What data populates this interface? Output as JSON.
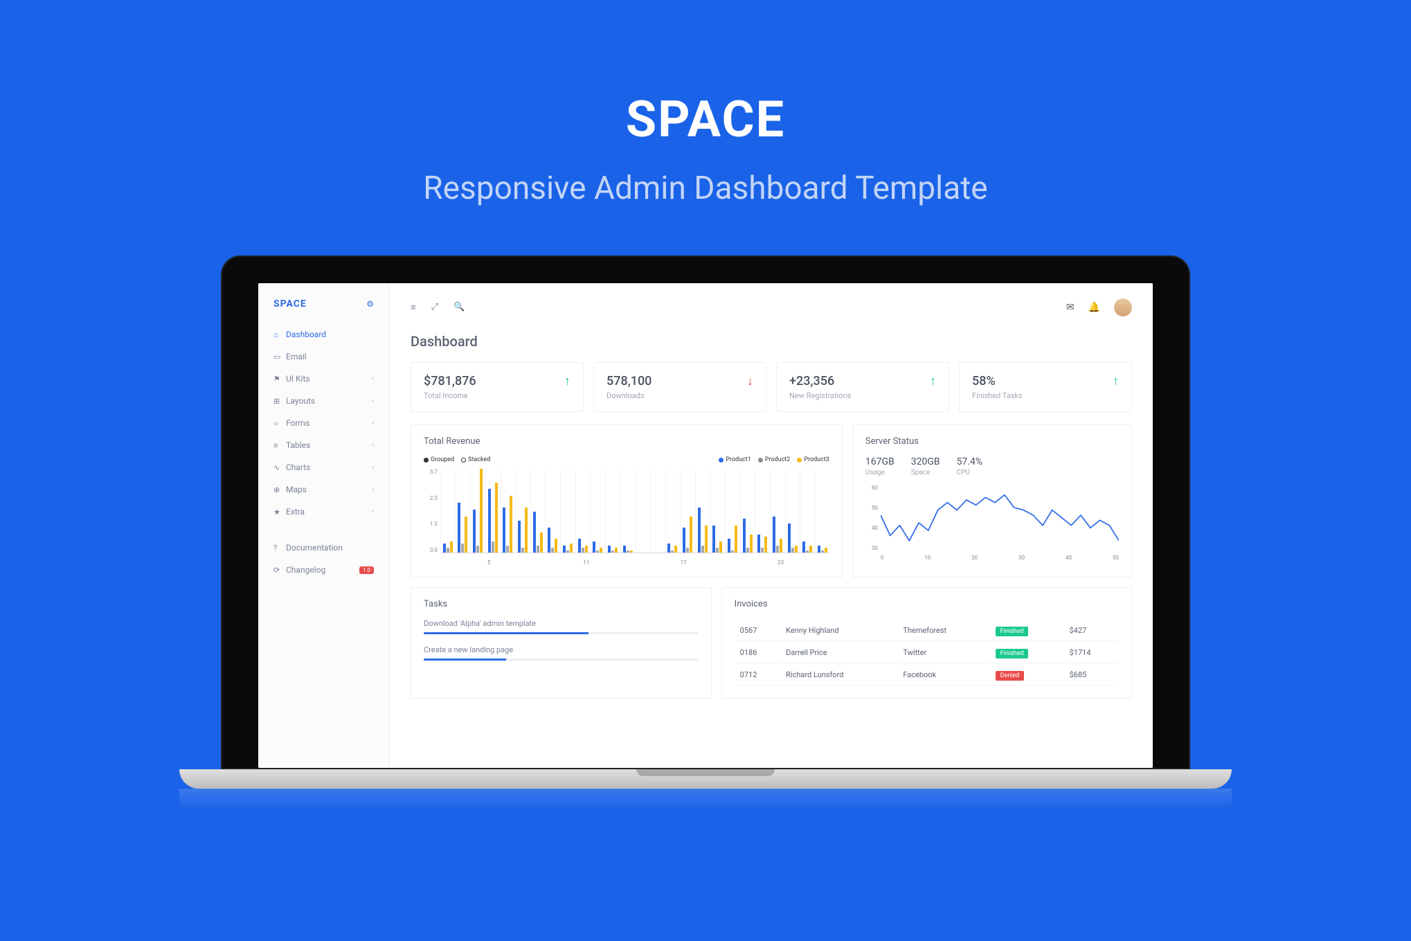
{
  "hero": {
    "title": "SPACE",
    "subtitle": "Responsive Admin Dashboard Template"
  },
  "sidebar": {
    "logo": "SPACE",
    "items": [
      {
        "icon": "⌂",
        "label": "Dashboard",
        "active": true
      },
      {
        "icon": "▭",
        "label": "Email"
      },
      {
        "icon": "⚑",
        "label": "UI Kits",
        "expand": true
      },
      {
        "icon": "⊞",
        "label": "Layouts",
        "expand": true
      },
      {
        "icon": "‹›",
        "label": "Forms",
        "expand": true
      },
      {
        "icon": "≡",
        "label": "Tables",
        "expand": true
      },
      {
        "icon": "∿",
        "label": "Charts",
        "expand": true
      },
      {
        "icon": "⊕",
        "label": "Maps",
        "expand": true
      },
      {
        "icon": "★",
        "label": "Extra",
        "expand": true
      }
    ],
    "footer": [
      {
        "icon": "?",
        "label": "Documentation"
      },
      {
        "icon": "⟳",
        "label": "Changelog",
        "badge": "1.0"
      }
    ]
  },
  "page": {
    "title": "Dashboard"
  },
  "stats": [
    {
      "value": "$781,876",
      "label": "Total Income",
      "trend": "up"
    },
    {
      "value": "578,100",
      "label": "Downloads",
      "trend": "down"
    },
    {
      "value": "+23,356",
      "label": "New Registrations",
      "trend": "up"
    },
    {
      "value": "58%",
      "label": "Finished Tasks",
      "trend": "up"
    }
  ],
  "revenue": {
    "title": "Total Revenue",
    "legend_left": [
      "Grouped",
      "Stacked"
    ],
    "legend_right": [
      "Product1",
      "Product2",
      "Product3"
    ],
    "y_ticks": [
      "3.7",
      "2.5",
      "1.2",
      "0.0"
    ],
    "x_ticks": [
      "5",
      "11",
      "17",
      "23"
    ]
  },
  "server": {
    "title": "Server Status",
    "stats": [
      {
        "value": "167GB",
        "label": "Usage"
      },
      {
        "value": "320GB",
        "label": "Space"
      },
      {
        "value": "57.4%",
        "label": "CPU"
      }
    ],
    "y_ticks": [
      "60",
      "50",
      "40",
      "30"
    ],
    "x_ticks": [
      "0",
      "10",
      "20",
      "30",
      "40",
      "50"
    ]
  },
  "tasks": {
    "title": "Tasks",
    "items": [
      {
        "name": "Download 'Alpha' admin template",
        "pct": 60
      },
      {
        "name": "Create a new landing page",
        "pct": 30
      }
    ]
  },
  "invoices": {
    "title": "Invoices",
    "rows": [
      {
        "id": "0567",
        "name": "Kenny Highland",
        "src": "Themeforest",
        "status": "Finished",
        "cls": "fin",
        "amt": "$427"
      },
      {
        "id": "0186",
        "name": "Darrell Price",
        "src": "Twitter",
        "status": "Finished",
        "cls": "fin",
        "amt": "$1714"
      },
      {
        "id": "0712",
        "name": "Richard Lunsford",
        "src": "Facebook",
        "status": "Denied",
        "cls": "den",
        "amt": "$685"
      }
    ]
  },
  "chart_data": [
    {
      "type": "bar",
      "title": "Total Revenue",
      "ylim": [
        0,
        3.7
      ],
      "x": [
        1,
        2,
        3,
        4,
        5,
        6,
        7,
        8,
        9,
        10,
        11,
        12,
        13,
        14,
        15,
        16,
        17,
        18,
        19,
        20,
        21,
        22,
        23,
        24,
        25,
        26
      ],
      "series": [
        {
          "name": "Product1",
          "color": "#2c6be6",
          "values": [
            0.4,
            2.2,
            1.9,
            2.8,
            2.0,
            1.4,
            1.8,
            1.1,
            0.3,
            0.6,
            0.5,
            0.3,
            0.3,
            0.0,
            0.0,
            0.4,
            1.1,
            2.0,
            1.2,
            0.6,
            1.5,
            0.8,
            1.6,
            1.3,
            0.5,
            0.3
          ]
        },
        {
          "name": "Product2",
          "color": "#8a8a8a",
          "values": [
            0.2,
            0.4,
            0.3,
            0.5,
            0.3,
            0.2,
            0.3,
            0.2,
            0.1,
            0.2,
            0.1,
            0.1,
            0.1,
            0.0,
            0.0,
            0.1,
            0.2,
            0.3,
            0.2,
            0.1,
            0.2,
            0.2,
            0.3,
            0.2,
            0.1,
            0.1
          ]
        },
        {
          "name": "Product3",
          "color": "#f5ba16",
          "values": [
            0.5,
            1.6,
            3.7,
            3.1,
            2.5,
            2.0,
            0.9,
            0.6,
            0.4,
            0.3,
            0.2,
            0.2,
            0.1,
            0.0,
            0.0,
            0.3,
            1.6,
            1.2,
            0.5,
            1.2,
            0.8,
            0.7,
            0.6,
            0.3,
            0.3,
            0.2
          ]
        }
      ]
    },
    {
      "type": "line",
      "title": "Server Status",
      "ylim": [
        30,
        60
      ],
      "x": [
        0,
        2,
        4,
        6,
        8,
        10,
        12,
        14,
        16,
        18,
        20,
        22,
        24,
        26,
        28,
        30,
        32,
        34,
        36,
        38,
        40,
        42,
        44,
        46,
        48,
        50
      ],
      "series": [
        {
          "name": "CPU",
          "color": "#2c6be6",
          "values": [
            48,
            40,
            44,
            38,
            45,
            42,
            50,
            53,
            50,
            54,
            52,
            55,
            53,
            56,
            51,
            50,
            48,
            44,
            50,
            47,
            44,
            48,
            43,
            46,
            44,
            38
          ]
        }
      ]
    }
  ]
}
